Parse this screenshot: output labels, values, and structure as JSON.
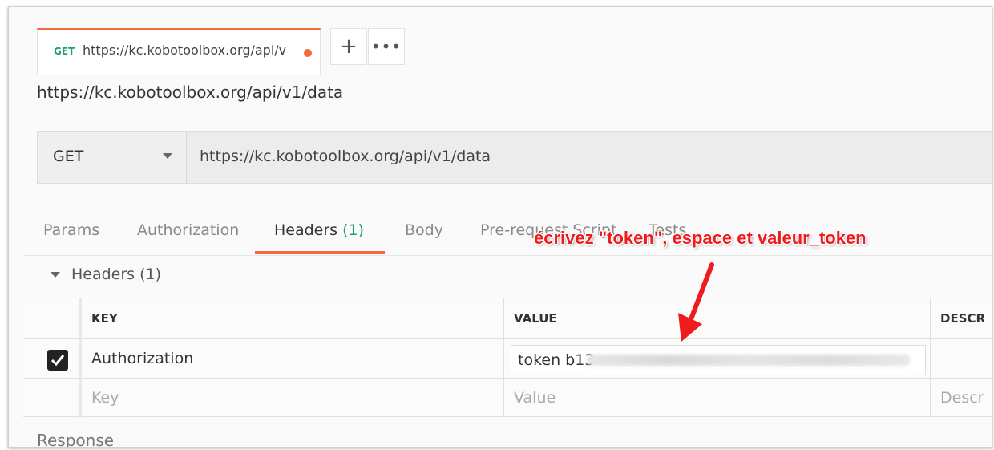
{
  "tab": {
    "method": "GET",
    "url": "https://kc.kobotoolbox.org/api/v",
    "unsaved": true
  },
  "tab_actions": {
    "add_symbol": "+",
    "more_symbol": "•••"
  },
  "request": {
    "title": "https://kc.kobotoolbox.org/api/v1/data",
    "method": "GET",
    "url": "https://kc.kobotoolbox.org/api/v1/data"
  },
  "subtabs": [
    {
      "label": "Params"
    },
    {
      "label": "Authorization"
    },
    {
      "label": "Headers",
      "count": "(1)"
    },
    {
      "label": "Body"
    },
    {
      "label": "Pre-request Script"
    },
    {
      "label": "Tests"
    }
  ],
  "headers_section": {
    "title": "Headers (1)",
    "columns": {
      "key": "KEY",
      "value": "VALUE",
      "description": "DESCR"
    },
    "rows": [
      {
        "checked": true,
        "key": "Authorization",
        "value": "token b13"
      }
    ],
    "empty_row": {
      "key": "Key",
      "value": "Value",
      "description": "Descr"
    }
  },
  "response_label": "Response",
  "annotation": {
    "text": "écrivez \"token\", espace et valeur_token",
    "color": "#ee1c1c"
  },
  "colors": {
    "accent": "#f26b3a",
    "get_method": "#1f9d6a"
  }
}
